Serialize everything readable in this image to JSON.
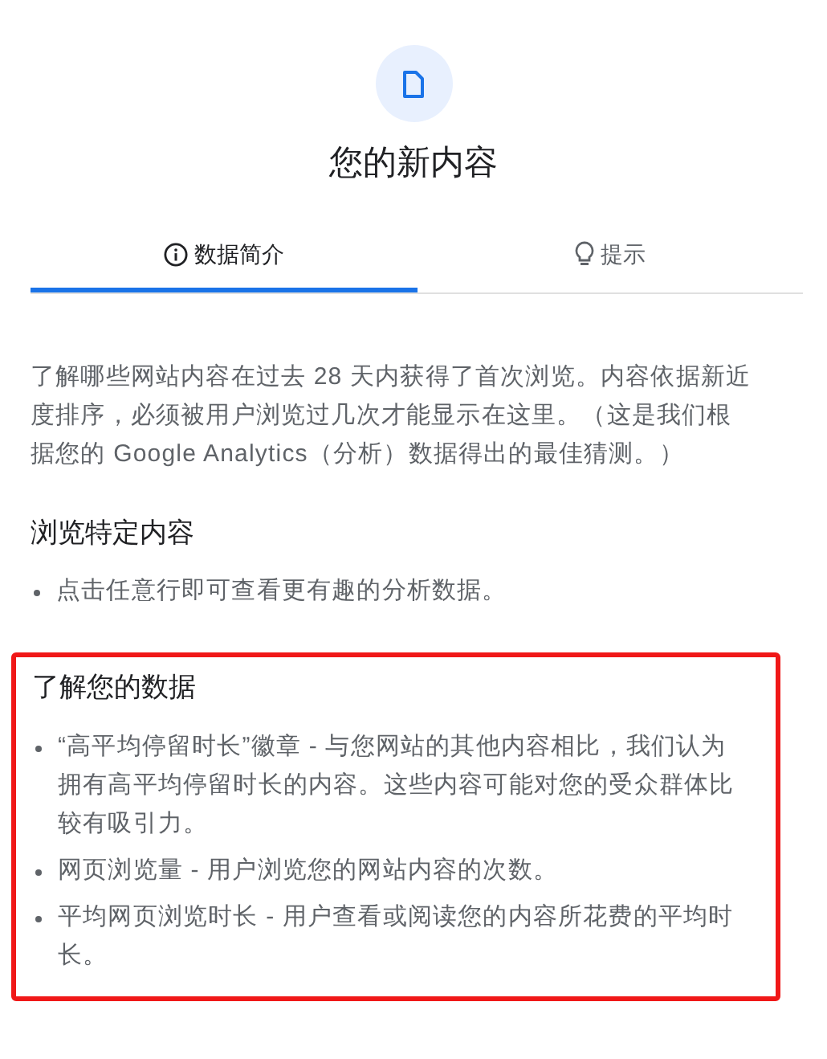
{
  "title": "您的新内容",
  "tabs": [
    {
      "label": "数据简介",
      "kind": "info",
      "selected": true
    },
    {
      "label": "提示",
      "kind": "bulb",
      "selected": false
    }
  ],
  "intro": "了解哪些网站内容在过去 28 天内获得了首次浏览。内容依据新近度排序，必须被用户浏览过几次才能显示在这里。（这是我们根据您的 Google Analytics（分析）数据得出的最佳猜测。）",
  "sections": [
    {
      "heading": "浏览特定内容",
      "highlighted": false,
      "bullets": [
        "点击任意行即可查看更有趣的分析数据。"
      ]
    },
    {
      "heading": "了解您的数据",
      "highlighted": true,
      "bullets": [
        "“高平均停留时长”徽章 - 与您网站的其他内容相比，我们认为拥有高平均停留时长的内容。这些内容可能对您的受众群体比较有吸引力。",
        "网页浏览量 - 用户浏览您的网站内容的次数。",
        "平均网页浏览时长 - 用户查看或阅读您的内容所花费的平均时长。"
      ]
    }
  ]
}
